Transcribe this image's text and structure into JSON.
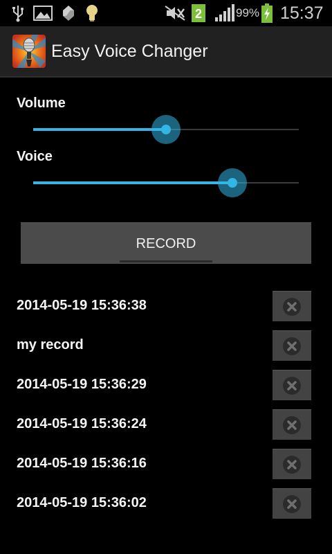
{
  "status_bar": {
    "icons": [
      "usb-icon",
      "image-icon",
      "sync-icon",
      "lightbulb-icon",
      "mute-icon",
      "sim-2-icon",
      "signal-icon",
      "battery-charging-icon"
    ],
    "sim_number": "2",
    "battery_percent": "99%",
    "time": "15:37"
  },
  "action_bar": {
    "title": "Easy Voice Changer",
    "icon": "microphone-app-icon"
  },
  "sliders": {
    "volume": {
      "label": "Volume",
      "value_fraction": 0.5
    },
    "voice": {
      "label": "Voice",
      "value_fraction": 0.75
    }
  },
  "record_button": {
    "label": "RECORD"
  },
  "records": [
    {
      "name": "2014-05-19 15:36:38"
    },
    {
      "name": "my record"
    },
    {
      "name": "2014-05-19 15:36:29"
    },
    {
      "name": "2014-05-19 15:36:24"
    },
    {
      "name": "2014-05-19 15:36:16"
    },
    {
      "name": "2014-05-19 15:36:02"
    }
  ],
  "colors": {
    "accent": "#33b5e5",
    "background": "#000000",
    "action_bar": "#212121",
    "button": "#4b4b4b"
  }
}
